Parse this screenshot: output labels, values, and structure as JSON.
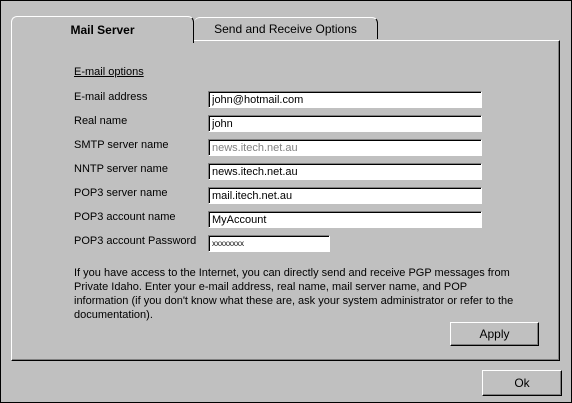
{
  "tabs": [
    {
      "label": "Mail Server",
      "active": true
    },
    {
      "label": "Send and Receive Options",
      "active": false
    }
  ],
  "section": {
    "title": "E-mail options"
  },
  "fields": [
    {
      "label": "E-mail address",
      "value": "john@hotmail.com"
    },
    {
      "label": "Real name",
      "value": "john"
    },
    {
      "label": "SMTP server name",
      "value": "news.itech.net.au",
      "disabled": true
    },
    {
      "label": "NNTP server name",
      "value": "news.itech.net.au"
    },
    {
      "label": "POP3 server name",
      "value": "mail.itech.net.au"
    },
    {
      "label": "POP3 account name",
      "value": "MyAccount"
    },
    {
      "label": "POP3 account Password",
      "value": "xxxxxxxx"
    }
  ],
  "info_text": "If you have access to the Internet, you can directly send and receive PGP messages from Private Idaho.  Enter your e-mail address, real name, mail server name, and POP information (if you don't know what these are, ask your system administrator or refer to the documentation).",
  "buttons": {
    "apply": "Apply",
    "ok": "Ok"
  }
}
